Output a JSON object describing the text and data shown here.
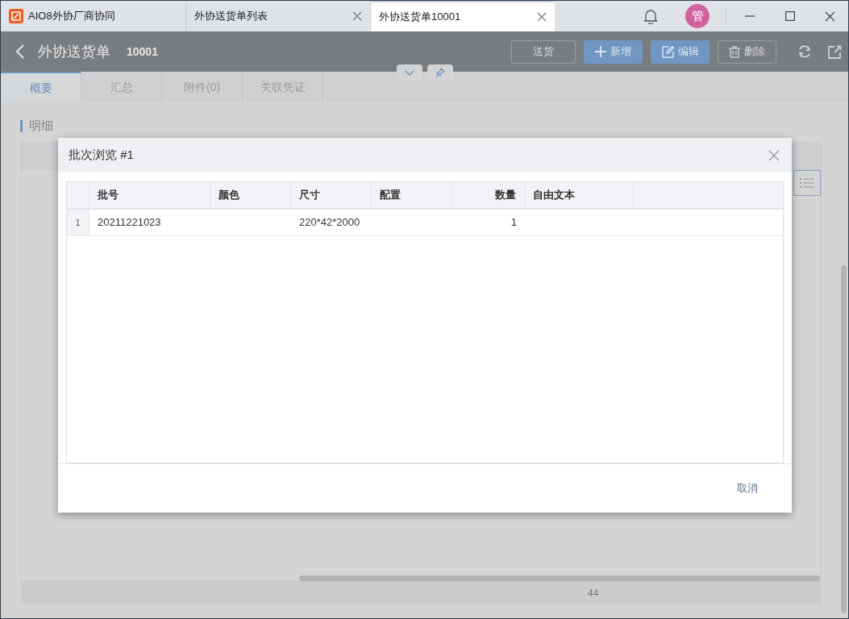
{
  "window_tabs": [
    {
      "label": "AIO8外协厂商协同",
      "kind": "app",
      "selected": false
    },
    {
      "label": "外协送货单列表",
      "kind": "doc",
      "selected": false
    },
    {
      "label": "外协送货单10001",
      "kind": "doc",
      "selected": true
    }
  ],
  "user_avatar": "管",
  "header": {
    "title": "外协送货单",
    "number": "10001",
    "actions": [
      {
        "label": "送货",
        "kind": "send"
      },
      {
        "label": "新增",
        "kind": "add"
      },
      {
        "label": "编辑",
        "kind": "edit"
      },
      {
        "label": "删除",
        "kind": "delete"
      }
    ]
  },
  "tabs": [
    {
      "label": "概要",
      "selected": true
    },
    {
      "label": "汇总",
      "selected": false
    },
    {
      "label": "附件(0)",
      "selected": false
    },
    {
      "label": "关联凭证",
      "selected": false
    }
  ],
  "section_title": "明细",
  "detail_table": {
    "footer_total": "44"
  },
  "dialog": {
    "title": "批次浏览 #1",
    "columns": [
      {
        "label": "批号",
        "kind": "text"
      },
      {
        "label": "颜色",
        "kind": "text"
      },
      {
        "label": "尺寸",
        "kind": "text"
      },
      {
        "label": "配置",
        "kind": "text"
      },
      {
        "label": "数量",
        "kind": "number"
      },
      {
        "label": "自由文本",
        "kind": "text"
      }
    ],
    "rows": [
      {
        "index": "1",
        "cells": [
          "20211221023",
          "",
          "220*42*2000",
          "",
          "1",
          ""
        ]
      }
    ],
    "buttons": [
      "取消"
    ]
  }
}
